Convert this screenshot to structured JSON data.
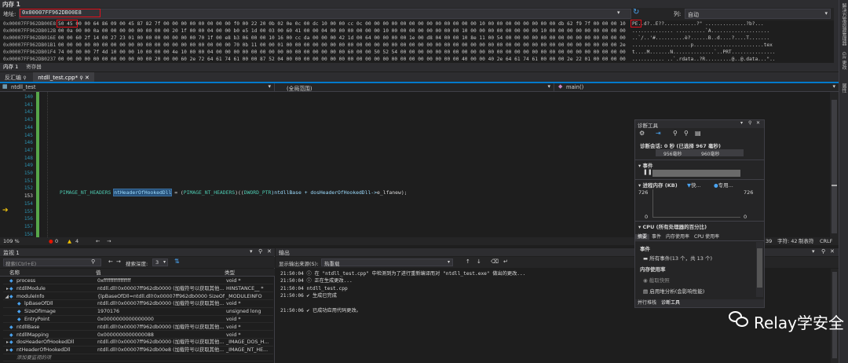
{
  "memory": {
    "window_title": "内存 1",
    "address_label": "地址:",
    "address_value": "0x00007FF962DB00E8",
    "columns_label": "列:",
    "columns_value": "自动",
    "rows": [
      {
        "addr": "0x00007FF962DB00E8",
        "hex": "50 45 00 00 64 86 09 00 45 87 82 7f 00 00 00 00 00 00 00 00 f0 00 22 20 0b 02 0e 0c 00 dc 10 00 00 cc 0c 00 00 00 00 00 00 00 00 00 00 00 00 00 10 00 00 00 00 00 00 00 00 db 62 f9 7f 00 00 00 10 00 00 00 02 00 00 0a 00 00",
        "ascii": "PE..d?..E??...........?\" ..............?b?..."
      },
      {
        "addr": "0x00007FF962DB012B",
        "hex": "00 0a 00 00 0a 00 00 00 00 00 00 00 00 20 1f 00 00 04 00 00 b0 e5 1d 00 03 00 60 41 00 00 04 00 00 00 00 00 00 10 00 00 00 00 00 00 00 00 10 00 00 00 00 00 00 00 00 10 00 00 00 00 00 00 00 00 00 00 00 10 00 00 00",
        "ascii": ".............. ..........`A...................."
      },
      {
        "addr": "0x00007FF962DB016E",
        "hex": "00 00 60 2f 14 00 27 23 01 00 00 00 00 00 00 00 70 1f 00 e8 b3 06 00 00 10 16 00 cc da 00 00 00 42 1d 00 64 00 00 00 00 1e 00 d8 04 00 00 10 8e 11 00 54 00 00 00 00 00 00 00 00 00 00 00 00 00 00 00 00 00 00",
        "ascii": "..`/..'#..........è?......B..d....?....T......."
      },
      {
        "addr": "0x00007FF962DB01B1",
        "hex": "00 00 00 00 00 00 00 00 00 00 00 00 00 00 00 00 00 00 00 00 70 0b 11 00 00 01 00 00 00 00 00 00 00 00 00 00 00 00 00 00 00 00 00 00 00 00 00 00 00 00 00 00 00 00 00 00 00 00 00 00 00 00 00 00 2e 74 65 78",
        "ascii": "....................p........................tex"
      },
      {
        "addr": "0x00007FF962DB01F4",
        "hex": "74 00 00 00 7f 4d 10 00 00 10 00 00 00 4e 10 00 00 04 00 00 00 00 00 00 00 00 00 00 00 00 00 00 00 60 00 00 50 52 54 00 00 00 00 00 00 00 00 00 00 00 00 00 00 00 00 00 00 00 00 00 00 00 00 00 00 00 00 00 00",
        "ascii": "t....M.......N..............`..PRT..............."
      },
      {
        "addr": "0x00007FF962DB0237",
        "hex": "00 00 00 00 00 00 00 00 00 00 00 20 00 00 60 2e 72 64 61 74 61 00 00 87 52 04 00 00 00 00 00 00 00 00 00 00 00 00 00 00 00 00 00 00 00 00 40 00 00 40 2e 64 61 74 61 00 00 00 2e 22 01 00 00 00 00 15 00 00 40",
        "ascii": "........... ..`.rdata..?R.........@..@.data...\".."
      }
    ],
    "bottom_tabs": [
      "内存 1",
      "寄存器"
    ]
  },
  "side_tabs": [
    "解决方案资源管理器",
    "Git 更改",
    "属性"
  ],
  "editor": {
    "tabs": [
      {
        "label": "反汇编"
      },
      {
        "label": "ntdll_test.cpp*"
      }
    ],
    "project": "ntdll_test",
    "scope": "(全局范围)",
    "function": "main()",
    "line_numbers": [
      "140",
      "141",
      "142",
      "143",
      "144",
      "145",
      "146",
      "147",
      "148",
      "149",
      "150",
      "151",
      "152",
      "153",
      "154",
      "155",
      "156",
      "157",
      "158"
    ],
    "code_tokens": {
      "t1": "PIMAGE_NT_HEADERS ",
      "t2": "ntHeaderOfHookedDll",
      "t3": " = (",
      "t4": "PIMAGE_NT_HEADERS",
      "t5": ")((",
      "t6": "DWORD_PTR",
      "t7": ")ntdllBase + dosHeaderOfHookedDll->",
      "t8": "e_lfanew",
      "t9": ");"
    },
    "status": {
      "zoom": "109 %",
      "errors": "0",
      "warnings": "4",
      "line": "39",
      "char": "字符: 42",
      "tab": "制表符",
      "eol": "CRLF"
    }
  },
  "diag": {
    "title": "诊断工具",
    "session": "诊断会话: 0 秒 (已选择 967 毫秒)",
    "tick1": "956毫秒",
    "tick2": "960毫秒",
    "events_label": "事件",
    "mem_label": "进程内存 (KB)",
    "fast_legend": "快...",
    "private_legend": "专用...",
    "mem_max_left": "726",
    "mem_max_right": "726",
    "mem_min_left": "0",
    "mem_min_right": "0",
    "cpu_label": "CPU (所有处理器的百分比)",
    "tabs": [
      "摘要",
      "事件",
      "内存使用率",
      "CPU 使用率"
    ],
    "section_events": "事件",
    "all_events": "所有事件(13 个，共 13 个)",
    "mem_usage": "内存使用率",
    "snapshot": "截取快照",
    "heap": "启用堆分析(会影响性能)",
    "footer_tabs": [
      "并行堆栈",
      "诊断工具"
    ]
  },
  "watch": {
    "title": "监视 1",
    "search_placeholder": "搜索(Ctrl+E)",
    "depth_label": "搜索深度:",
    "depth_value": "3",
    "headers": [
      "名称",
      "值",
      "类型"
    ],
    "rows": [
      {
        "name": "process",
        "value": "0xffffffffffffffff",
        "type": "void *",
        "indent": 0
      },
      {
        "name": "ntdllModule",
        "value": "ntdll.dll!0x00007ff962db0000 (加载符号以获取其他...",
        "type": "HINSTANCE__ *",
        "indent": 0
      },
      {
        "name": "moduleInfo",
        "value": "{lpBaseOfDll=ntdll.dll!0x00007ff962db0000 SizeOfIm...",
        "type": "_MODULEINFO",
        "indent": 0
      },
      {
        "name": "lpBaseOfDll",
        "value": "ntdll.dll!0x00007ff962db0000 (加载符号以获取其他...",
        "type": "void *",
        "indent": 1
      },
      {
        "name": "SizeOfImage",
        "value": "1970176",
        "type": "unsigned long",
        "indent": 1
      },
      {
        "name": "EntryPoint",
        "value": "0x0000000000000000",
        "type": "void *",
        "indent": 1
      },
      {
        "name": "ntdllBase",
        "value": "ntdll.dll!0x00007ff962db0000 (加载符号以获取其他...",
        "type": "void *",
        "indent": 0
      },
      {
        "name": "ntdllMapping",
        "value": "0x0000000000000088",
        "type": "void *",
        "indent": 0
      },
      {
        "name": "dosHeaderOfHookedDll",
        "value": "ntdll.dll!0x00007ff962db0000 (加载符号以获取其他...",
        "type": "_IMAGE_DOS_H...",
        "indent": 0
      },
      {
        "name": "ntHeaderOfHookedDll",
        "value": "ntdll.dll!0x00007ff962db00e8 (加载符号以获取其他...",
        "type": "_IMAGE_NT_HE...",
        "indent": 0
      },
      {
        "name": "添加要监视的项",
        "value": "",
        "type": "",
        "indent": 0
      }
    ]
  },
  "output": {
    "title": "输出",
    "source_label": "显示输出来源(S):",
    "source_value": "热重载",
    "lines": [
      "21:50:04 ⓘ 在 \"ntdll_test.cpp\" 中检测到为了进行重新编译而对 \"ntdll_test.exe\" 做出的更改...",
      "21:50:04 ⓘ 正在生成更改...",
      "21:50:04 ntdll_test.cpp",
      "21:50:06 ✔ 生成已完成",
      "",
      "21:50:06 ✔ 已成功应用代码更改。"
    ]
  },
  "watermark": {
    "text": "Relay学安全"
  }
}
